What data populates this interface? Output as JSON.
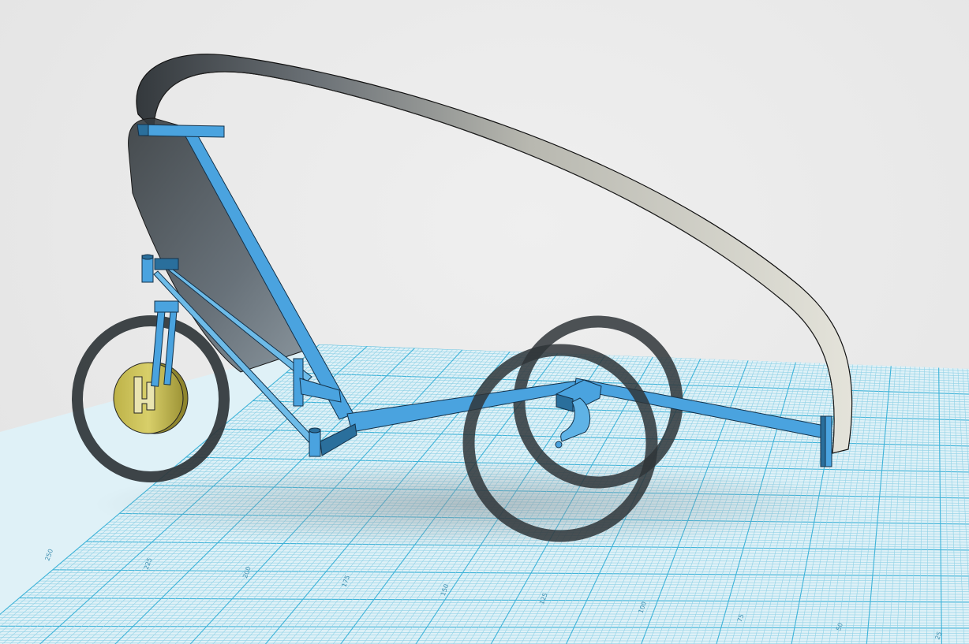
{
  "viewport": {
    "name": "3d-design-viewport",
    "colors": {
      "background": "#e9e9e9",
      "grid_fill": "#dff1f7",
      "grid_minor": "#8fd1e6",
      "grid_major": "#3fb3d8",
      "frame_blue": "#4aa3df",
      "frame_edge": "#14324a",
      "tire": "#2f3538",
      "hub": "#c9bf52",
      "canopy_dark": "#3b4146",
      "canopy_light": "#d9d9d2"
    }
  },
  "grid": {
    "ruler_labels": [
      "250",
      "225",
      "200",
      "175",
      "150",
      "125",
      "100",
      "75",
      "50",
      "25"
    ]
  },
  "model": {
    "name": "recumbent-trike-with-canopy",
    "parts": [
      "canopy",
      "seat-back",
      "front-wheel",
      "rear-wheel-near",
      "rear-wheel-far",
      "frame",
      "front-hub"
    ]
  }
}
